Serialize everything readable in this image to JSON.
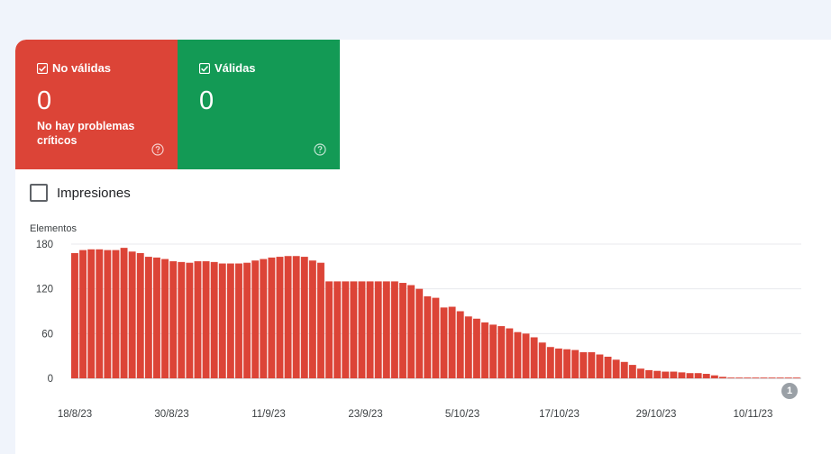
{
  "tiles": {
    "invalid": {
      "label": "No válidas",
      "count": "0",
      "subtitle": "No hay problemas críticos",
      "checked": true,
      "color": "#dc4437"
    },
    "valid": {
      "label": "Válidas",
      "count": "0",
      "checked": true,
      "color": "#139a55"
    }
  },
  "impressions": {
    "label": "Impresiones",
    "checked": false
  },
  "annotation_badge": "1",
  "chart_data": {
    "type": "bar",
    "ylabel": "Elementos",
    "ylim": [
      0,
      180
    ],
    "yticks": [
      "180",
      "120",
      "60",
      "0"
    ],
    "xticks": [
      "18/8/23",
      "30/8/23",
      "11/9/23",
      "23/9/23",
      "5/10/23",
      "17/10/23",
      "29/10/23",
      "10/11/23"
    ],
    "bar_color": "#dc4437",
    "grid": true,
    "series": [
      {
        "values": [
          168,
          172,
          173,
          173,
          172,
          172,
          175,
          170,
          168,
          163,
          162,
          160,
          157,
          156,
          155,
          157,
          157,
          156,
          154,
          154,
          154,
          155,
          158,
          160,
          162,
          163,
          164,
          164,
          163,
          158,
          155,
          130,
          130,
          130,
          130,
          130,
          130,
          130,
          130,
          130,
          128,
          125,
          120,
          110,
          108,
          95,
          96,
          90,
          83,
          80,
          75,
          72,
          70,
          67,
          62,
          60,
          55,
          48,
          42,
          40,
          39,
          38,
          35,
          35,
          32,
          29,
          25,
          22,
          18,
          13,
          11,
          10,
          9,
          9,
          8,
          7,
          7,
          6,
          4,
          2,
          1,
          1,
          1,
          1,
          1,
          1,
          1,
          1,
          1
        ]
      }
    ]
  }
}
